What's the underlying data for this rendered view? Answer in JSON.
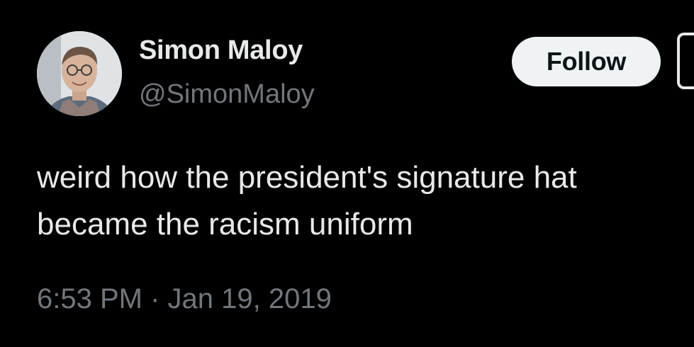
{
  "author": {
    "display_name": "Simon Maloy",
    "handle": "@SimonMaloy",
    "avatar_icon": "profile-photo"
  },
  "actions": {
    "follow_label": "Follow",
    "more_icon": "more-options-icon"
  },
  "tweet": {
    "text": "weird how the president's signature hat\nbecame the racism uniform",
    "timestamp": "6:53 PM · Jan 19, 2019"
  },
  "colors": {
    "background": "#000000",
    "primary_text": "#e7e9ea",
    "secondary_text": "#71767b",
    "follow_button_bg": "#eff3f4",
    "follow_button_text": "#0f1419"
  }
}
